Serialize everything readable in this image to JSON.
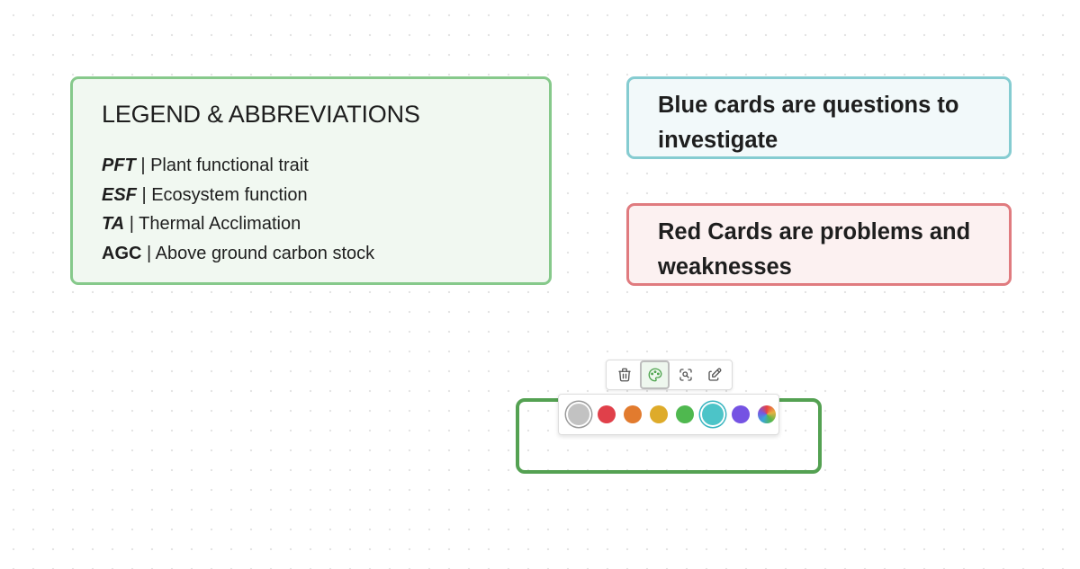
{
  "legend": {
    "title": "LEGEND & ABBREVIATIONS",
    "rows": [
      {
        "abbr": "PFT",
        "separator": " | ",
        "text": "Plant functional trait",
        "italic": true
      },
      {
        "abbr": "ESF",
        "separator": " | ",
        "text": "Ecosystem function",
        "italic": true
      },
      {
        "abbr": "TA",
        "separator": " | ",
        "text": "Thermal Acclimation",
        "italic": true
      },
      {
        "abbr": "AGC",
        "separator": " | ",
        "text": "Above ground carbon stock",
        "italic": false
      }
    ],
    "border_color": "#86c98b",
    "fill_color": "#f1f8f1"
  },
  "blue_card": {
    "line1": "Blue cards are questions to",
    "line2": "investigate",
    "border_color": "#85ccd1",
    "fill_color": "#f2f9fa"
  },
  "red_card": {
    "line1": "Red Cards are problems and",
    "line2": "weaknesses",
    "border_color": "#e07b7f",
    "fill_color": "#fcf1f1"
  },
  "selected_card": {
    "border_color": "#54a152"
  },
  "toolbar": {
    "buttons": [
      {
        "name": "delete",
        "icon": "trash-icon",
        "active": false
      },
      {
        "name": "color",
        "icon": "palette-icon",
        "active": true
      },
      {
        "name": "zoom",
        "icon": "focus-search-icon",
        "active": false
      },
      {
        "name": "edit",
        "icon": "edit-icon",
        "active": false
      }
    ]
  },
  "palette": {
    "colors": [
      {
        "name": "gray",
        "hex": "#c2c2c2",
        "state": "selected"
      },
      {
        "name": "red",
        "hex": "#e0404a",
        "state": ""
      },
      {
        "name": "orange",
        "hex": "#e27b2e",
        "state": ""
      },
      {
        "name": "yellow",
        "hex": "#deab2a",
        "state": ""
      },
      {
        "name": "green",
        "hex": "#4fb84f",
        "state": ""
      },
      {
        "name": "teal",
        "hex": "#4cc4c8",
        "state": "ring"
      },
      {
        "name": "purple",
        "hex": "#7553e3",
        "state": ""
      },
      {
        "name": "custom",
        "hex": "",
        "state": "rainbow"
      }
    ]
  }
}
